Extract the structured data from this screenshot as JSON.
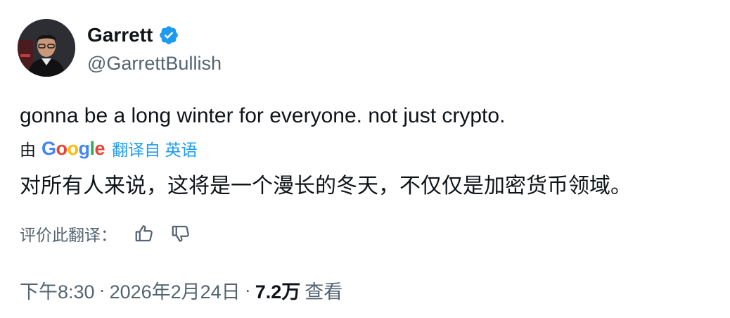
{
  "author": {
    "name": "Garrett",
    "handle": "@GarrettBullish",
    "verified": true
  },
  "tweet": {
    "text": "gonna be a long winter for everyone. not just crypto."
  },
  "translation": {
    "by": "由",
    "provider_letters": [
      "G",
      "o",
      "o",
      "g",
      "l",
      "e"
    ],
    "link_label": "翻译自 英语",
    "text": "对所有人来说，这将是一个漫长的冬天，不仅仅是加密货币领域。"
  },
  "rating": {
    "label": "评价此翻译："
  },
  "meta": {
    "time": "下午8:30",
    "separator": "·",
    "date": "2026年2月24日",
    "views_count": "7.2万",
    "views_label": "查看"
  },
  "colors": {
    "text_primary": "#0f1419",
    "text_secondary": "#536471",
    "link": "#1d9bf0",
    "verified_badge": "#1d9bf0"
  },
  "icons": {
    "verified": "verified-badge-icon",
    "thumbs_up": "thumbs-up-icon",
    "thumbs_down": "thumbs-down-icon"
  }
}
